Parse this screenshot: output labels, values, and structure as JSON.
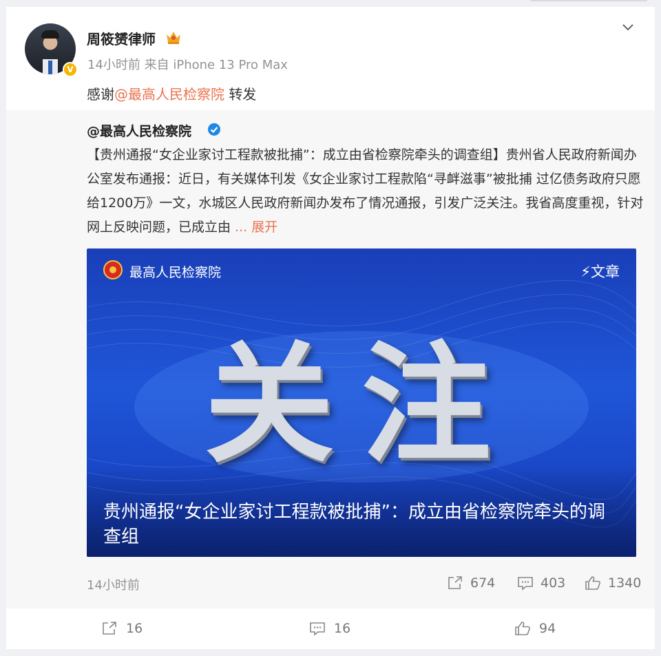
{
  "post": {
    "author": "周筱赟律师",
    "meta": "14小时前  来自 iPhone 13 Pro Max",
    "comment_prefix": "感谢",
    "comment_mention": "@最高人民检察院",
    "comment_suffix": " 转发"
  },
  "repost": {
    "source": "@最高人民检察院",
    "body": "【贵州通报“女企业家讨工程款被批捕”：成立由省检察院牵头的调查组】贵州省人民政府新闻办公室发布通报：近日，有关媒体刊发《女企业家讨工程款陷“寻衅滋事”被批捕 过亿债务政府只愿给1200万》一文，水城区人民政府新闻办发布了情况通报，引发广泛关注。我省高度重视，针对网上反映问题，已成立由 ",
    "more": "... 展开",
    "article": {
      "source": "最高人民检察院",
      "tag": "⚡文章",
      "big_text": "关注",
      "title": "贵州通报“女企业家讨工程款被批捕”：成立由省检察院牵头的调查组"
    },
    "time": "14小时前",
    "reposts": "674",
    "comments": "403",
    "likes": "1340"
  },
  "footer": {
    "reposts": "16",
    "comments": "16",
    "likes": "94"
  },
  "colors": {
    "accent": "#eb7350",
    "verified_blue": "#1e88e5",
    "verified_gold": "#f7b500"
  }
}
